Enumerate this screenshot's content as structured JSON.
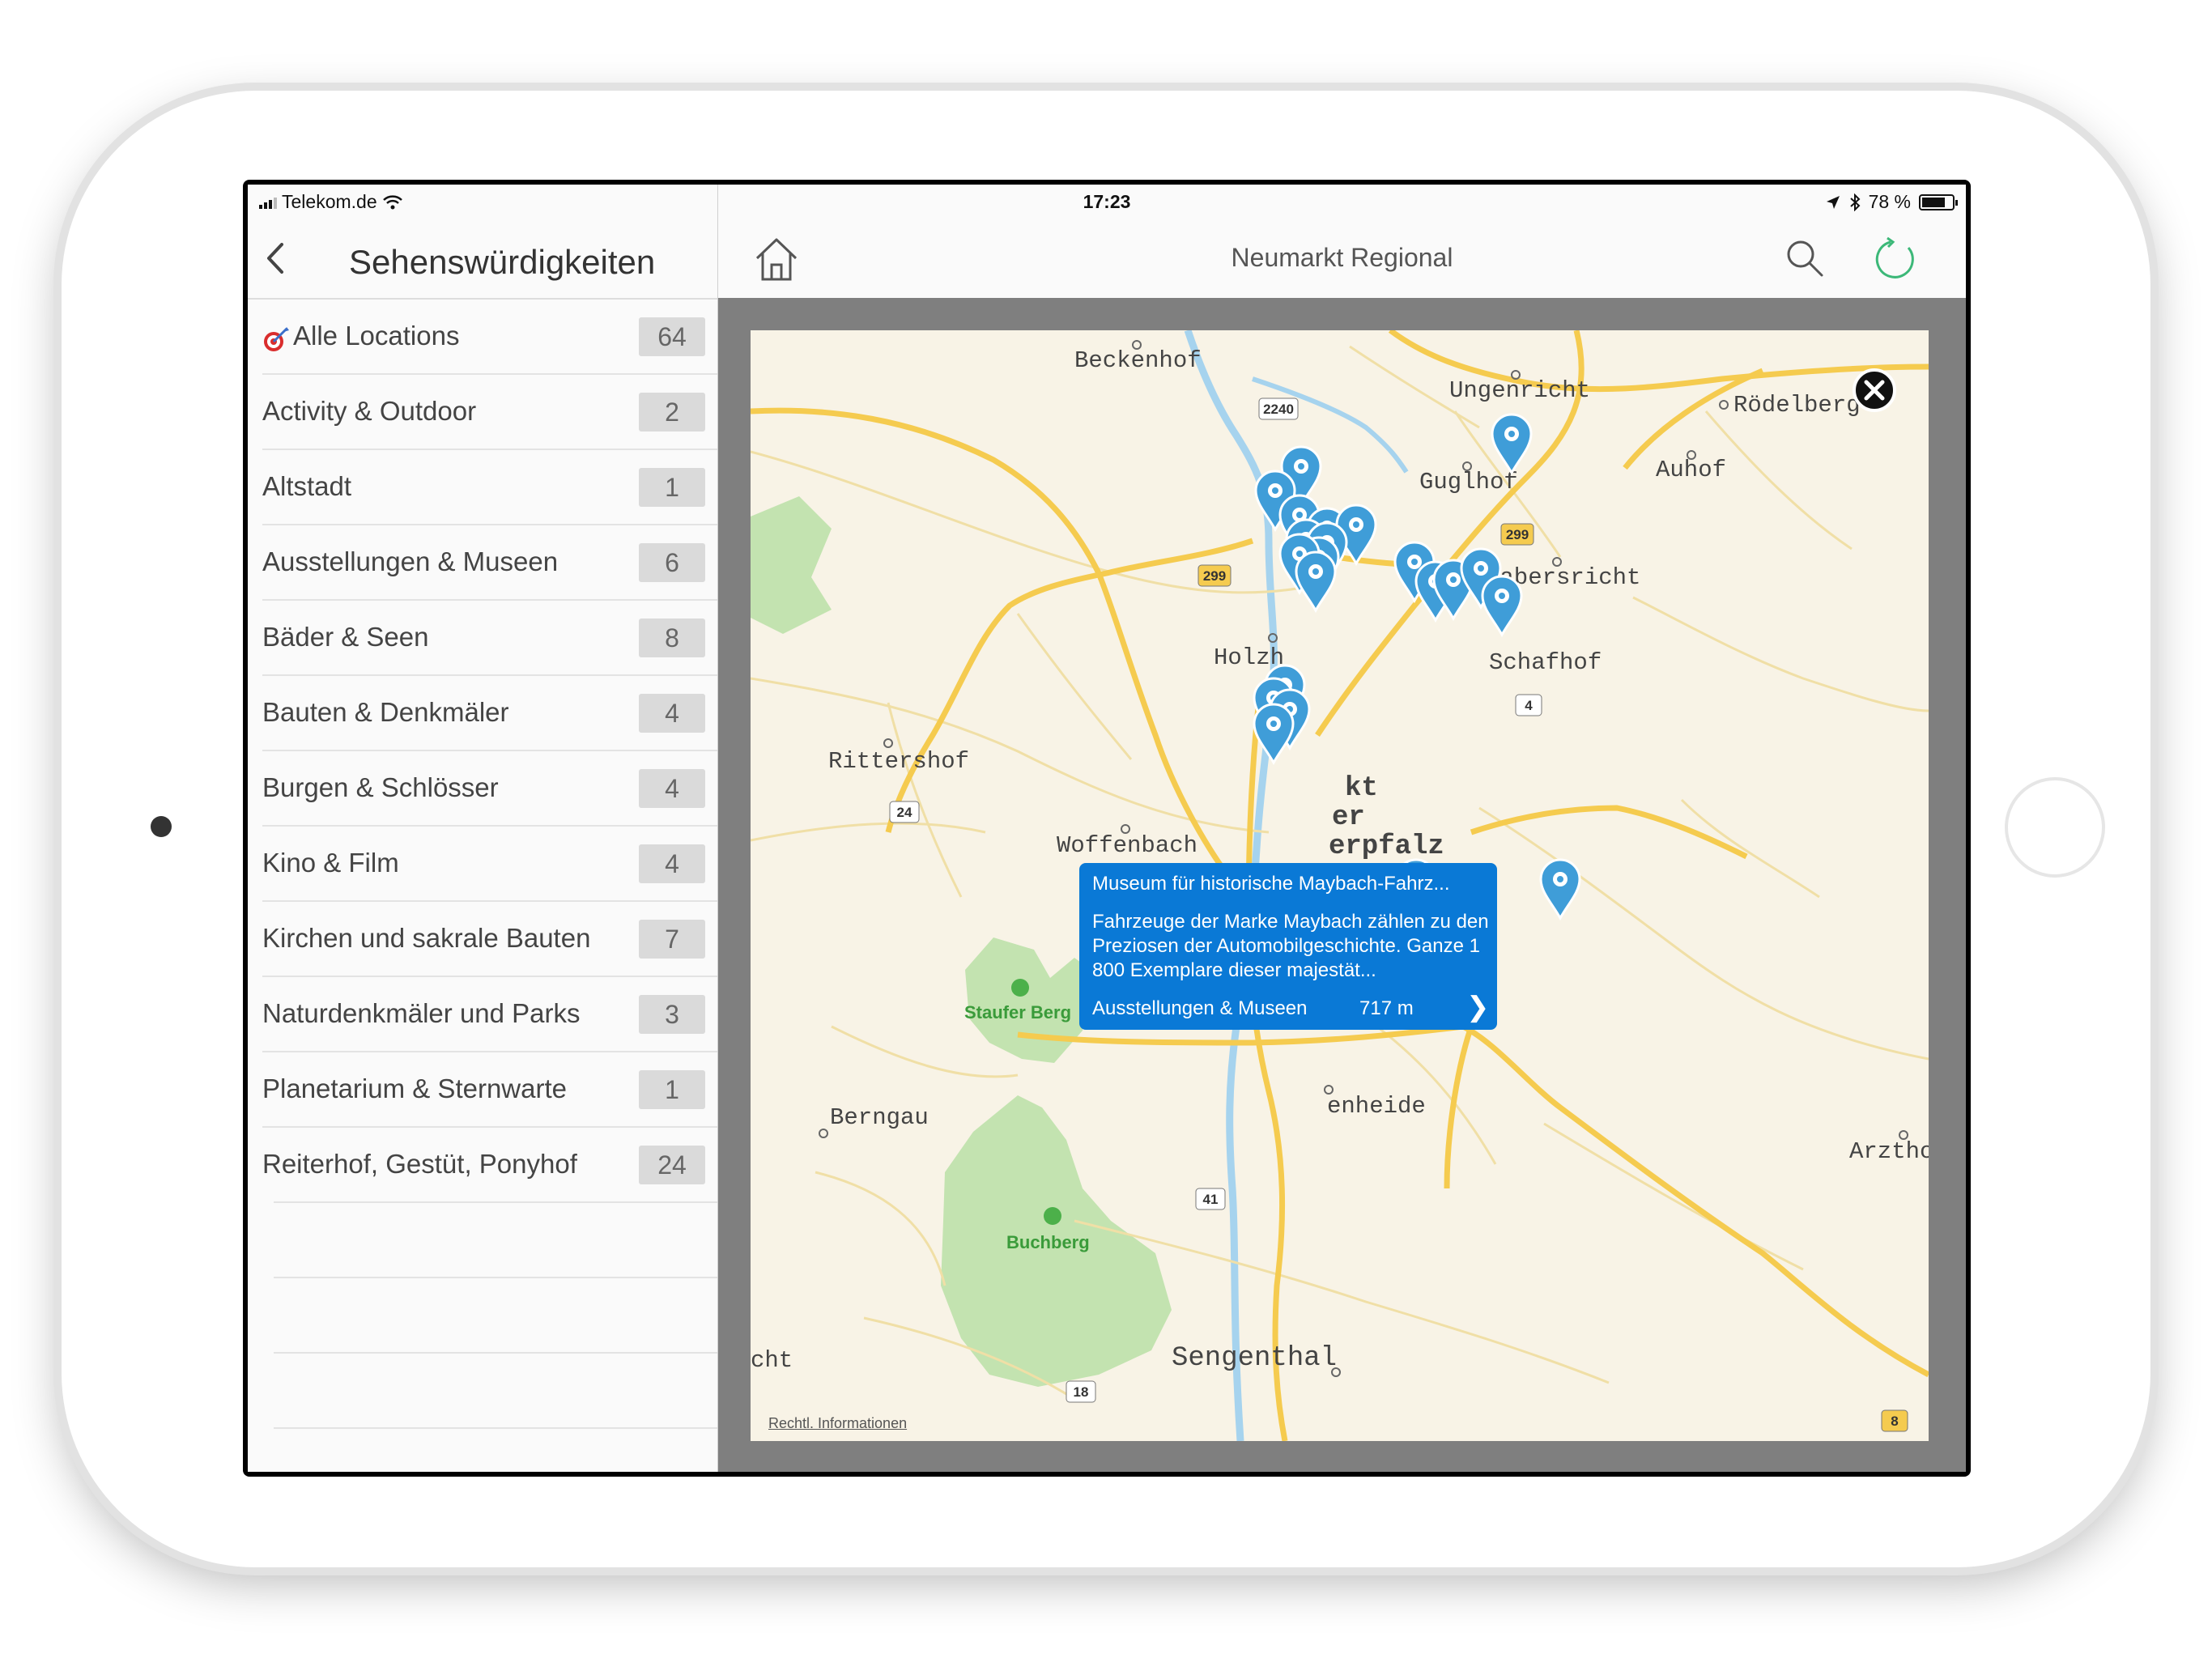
{
  "status": {
    "carrier": "Telekom.de",
    "time": "17:23",
    "battery": "78 %",
    "battery_level": 0.78
  },
  "sidebar": {
    "title": "Sehenswürdigkeiten",
    "items": [
      {
        "label": "Alle Locations",
        "count": "64"
      },
      {
        "label": "Activity & Outdoor",
        "count": "2"
      },
      {
        "label": "Altstadt",
        "count": "1"
      },
      {
        "label": "Ausstellungen & Museen",
        "count": "6"
      },
      {
        "label": "Bäder & Seen",
        "count": "8"
      },
      {
        "label": "Bauten & Denkmäler",
        "count": "4"
      },
      {
        "label": "Burgen & Schlösser",
        "count": "4"
      },
      {
        "label": "Kino & Film",
        "count": "4"
      },
      {
        "label": "Kirchen und sakrale Bauten",
        "count": "7"
      },
      {
        "label": "Naturdenkmäler und Parks",
        "count": "3"
      },
      {
        "label": "Planetarium & Sternwarte",
        "count": "1"
      },
      {
        "label": "Reiterhof, Gestüt, Ponyhof",
        "count": "24"
      }
    ]
  },
  "header": {
    "title": "Neumarkt Regional"
  },
  "map": {
    "places": [
      "Beckenhof",
      "Ungenricht",
      "Rödelberg",
      "Auhof",
      "Guglhof",
      "Labersricht",
      "Schafhof",
      "Holzheim",
      "Rittershof",
      "Woffenbach",
      "Neumarkt in der Oberpfalz",
      "Staufer Berg",
      "Berngau",
      "Hasenheide",
      "Arzthofen",
      "Buchberg",
      "Sengenthal",
      "cht"
    ],
    "places_display": [
      "Beckenhof",
      "Ungenricht",
      "Rödelberg",
      "Auhof",
      "Guglhof",
      "Labersricht",
      "Schafhof",
      "Holzh",
      "Rittershof",
      "Woffenbach",
      "kt",
      "er",
      "erpfalz",
      "Staufer Berg",
      "Berngau",
      "enheide",
      "Arztho",
      "Buchberg",
      "Sengenthal",
      "cht"
    ],
    "road_labels": [
      "2240",
      "299",
      "299",
      "4",
      "24",
      "41",
      "18",
      "8"
    ],
    "legal": "Rechtl. Informationen",
    "pin_color": "#3f9dd8",
    "water_color": "#a6d3ee",
    "park_color": "#c3e3b0",
    "road_color": "#f5cb4f"
  },
  "callout": {
    "title": "Museum für historische Maybach-Fahrz...",
    "description": "Fahrzeuge der Marke Maybach zählen zu den Preziosen der Automobilgeschichte. Ganze 1 800 Exemplare dieser majestät...",
    "category": "Ausstellungen & Museen",
    "distance": "717 m",
    "background": "#0a79d6"
  },
  "colors": {
    "accent_refresh": "#3cb878"
  }
}
